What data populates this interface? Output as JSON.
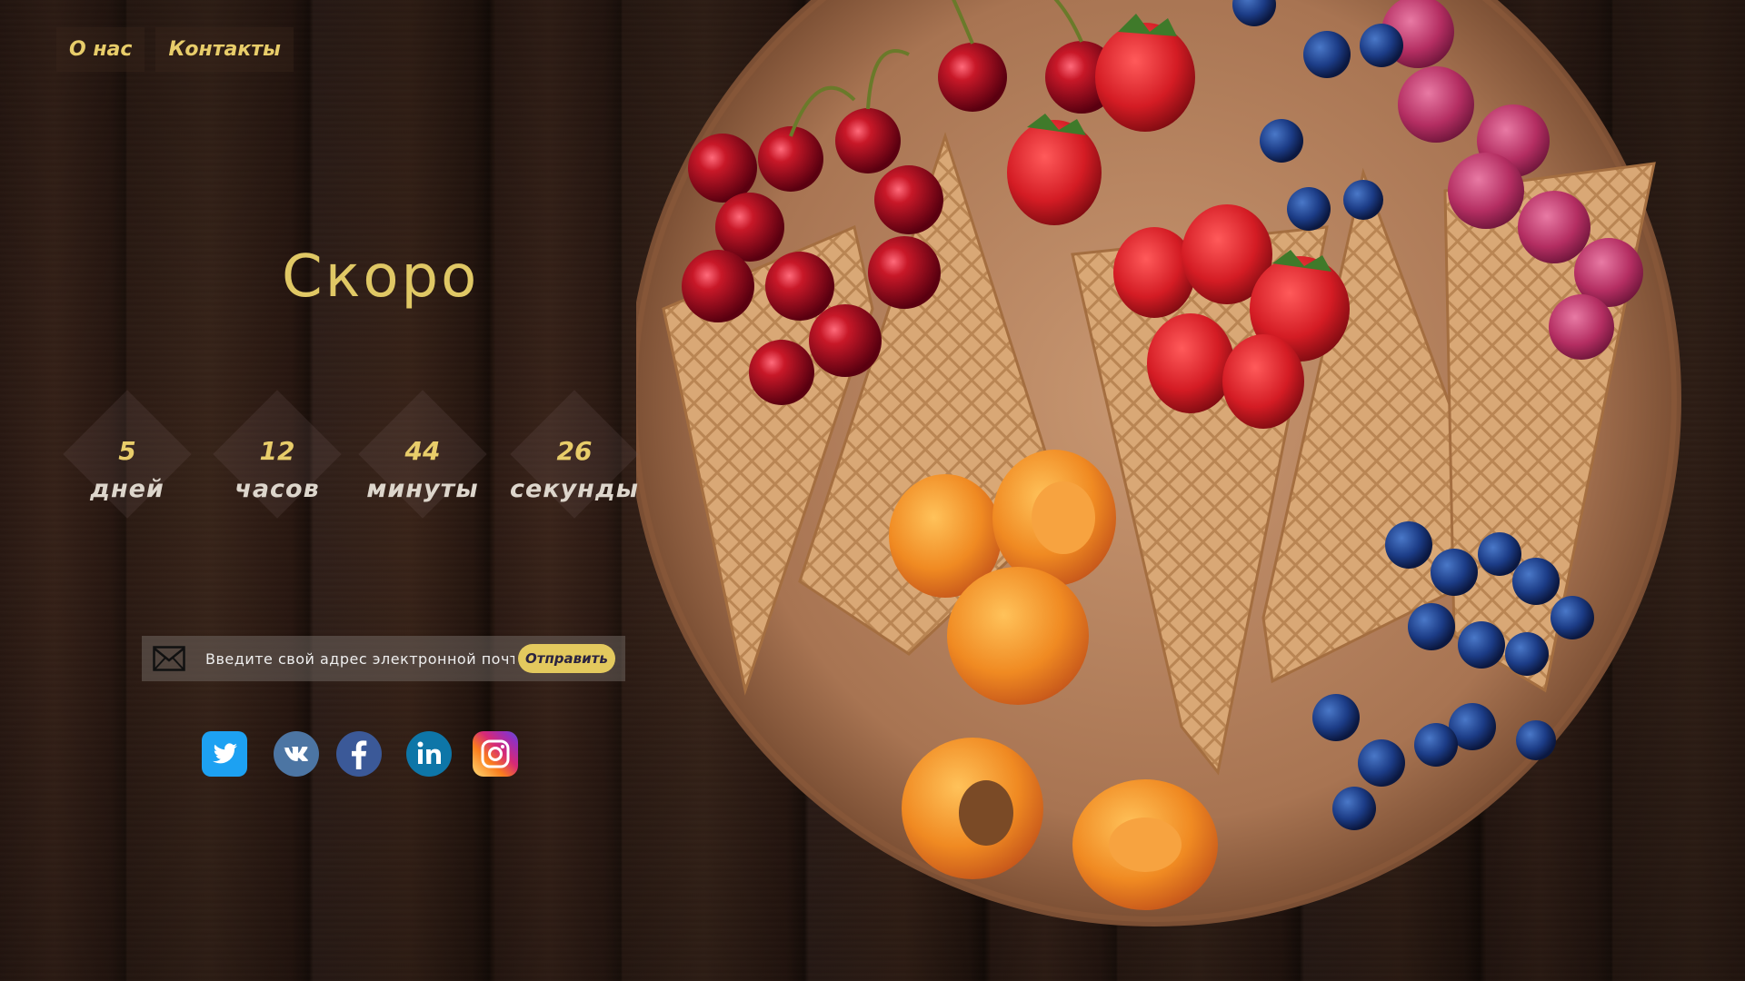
{
  "nav": {
    "items": [
      {
        "label": "О нас"
      },
      {
        "label": "Контакты"
      }
    ]
  },
  "hero": {
    "title": "Скоро"
  },
  "countdown": {
    "days": {
      "value": "5",
      "unit": "дней"
    },
    "hours": {
      "value": "12",
      "unit": "часов"
    },
    "minutes": {
      "value": "44",
      "unit": "минуты"
    },
    "seconds": {
      "value": "26",
      "unit": "секунды"
    }
  },
  "subscribe": {
    "placeholder": "Введите свой адрес электронной почты",
    "button_label": "Отправить"
  },
  "social": {
    "icons": [
      "twitter-icon",
      "vk-icon",
      "facebook-icon",
      "linkedin-icon",
      "instagram-icon"
    ]
  },
  "colors": {
    "accent": "#e3c95e",
    "background": "#2d1b14"
  }
}
